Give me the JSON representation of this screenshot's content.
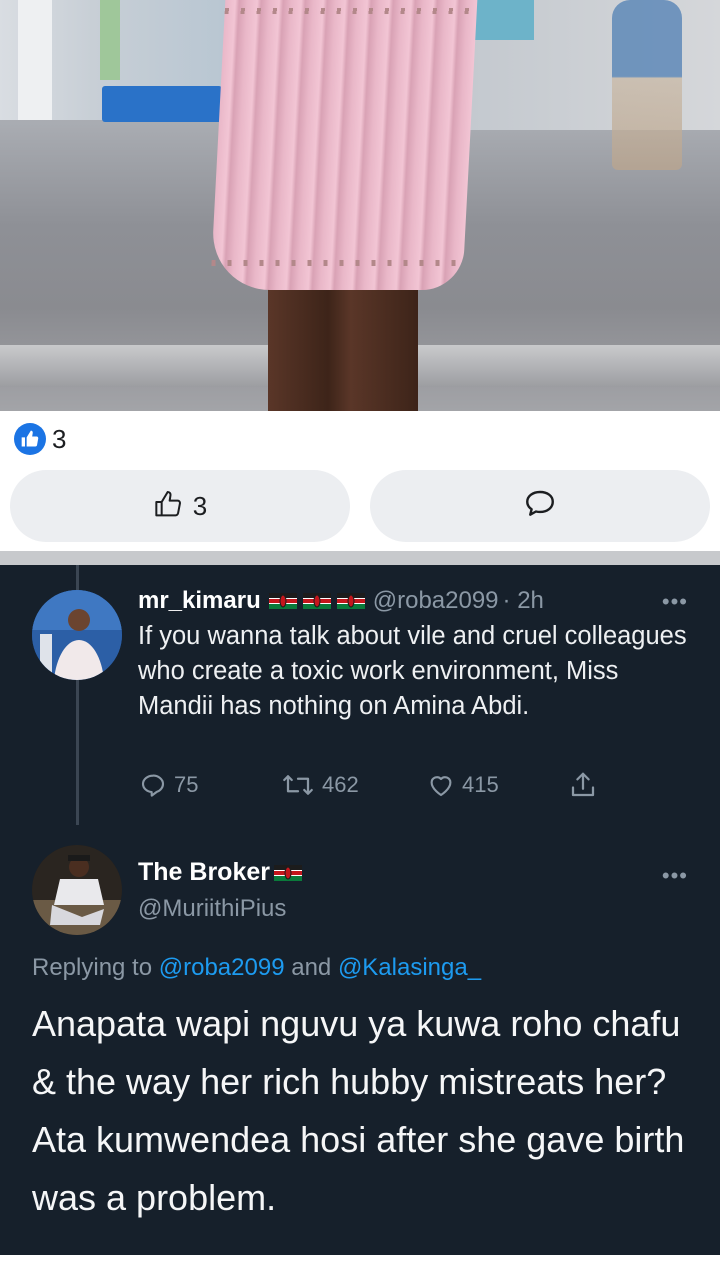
{
  "post": {
    "reaction_count": "3",
    "like_button_count": "3",
    "like_color": "#1b74e4"
  },
  "tweet1": {
    "name": "mr_kimaru",
    "handle": "@roba2099",
    "time": "· 2h",
    "text": "If you wanna talk about vile and cruel colleagues who create a toxic work environment, Miss Mandii has nothing on Amina Abdi.",
    "replies": "75",
    "retweets": "462",
    "likes": "415",
    "more": "•••"
  },
  "tweet2": {
    "name": "The Broker",
    "handle": "@MuriithiPius",
    "replying_prefix": "Replying to",
    "mention1": "@roba2099",
    "and": "and",
    "mention2": "@Kalasinga_",
    "text": "Anapata wapi nguvu ya kuwa roho chafu & the way her rich hubby mistreats her? Ata kumwendea hosi after she gave birth was a problem.",
    "more": "•••"
  },
  "colors": {
    "twitter_bg": "#16202b",
    "twitter_blue": "#1d9bf0",
    "muted": "#8b98a5"
  }
}
